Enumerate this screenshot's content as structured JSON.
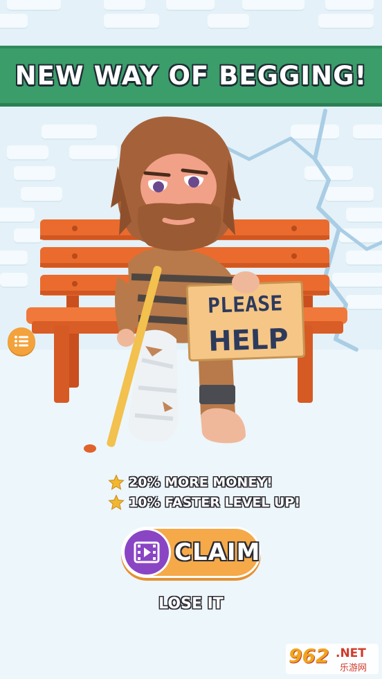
{
  "banner": {
    "title": "NEW WAY OF BEGGING!"
  },
  "scene": {
    "sign_line1": "PLEASE",
    "sign_line2": "HELP"
  },
  "menu_button": {
    "icon": "list-icon"
  },
  "perks": [
    {
      "icon": "star-icon",
      "text": "20% MORE MONEY!"
    },
    {
      "icon": "star-icon",
      "text": "10% FASTER LEVEL UP!"
    }
  ],
  "claim": {
    "label": "CLAIM",
    "icon": "video-icon"
  },
  "lose": {
    "label": "LOSE IT"
  },
  "watermark": {
    "number": "962",
    "suffix": ".NET",
    "subtitle": "乐游网"
  },
  "colors": {
    "banner": "#3a9d6a",
    "claim_button": "#f5a948",
    "video_circle": "#8a45c4",
    "menu_button": "#f3a23c",
    "bench": "#e8652a"
  }
}
